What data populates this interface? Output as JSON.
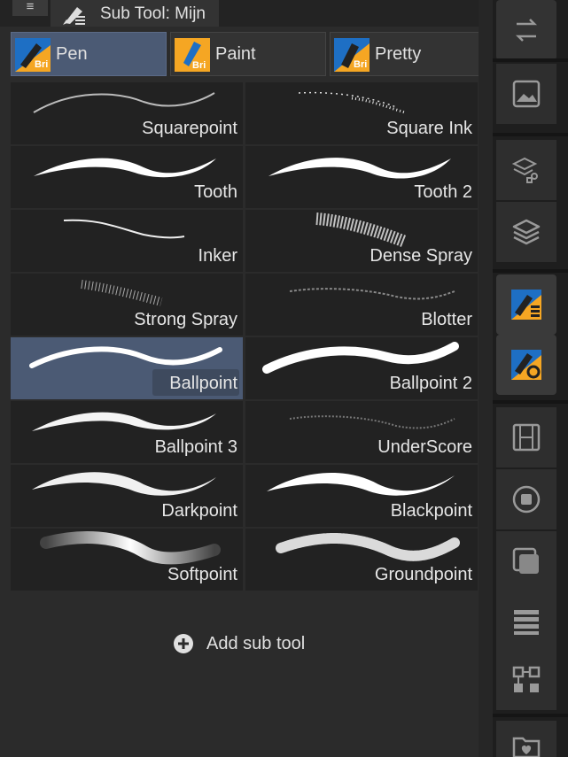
{
  "titlebar": {
    "menu_glyph": "≡",
    "title": "Sub Tool: Mijn"
  },
  "groups": [
    {
      "label": "Pen",
      "active": true,
      "icon": "pen-group-icon"
    },
    {
      "label": "Paint",
      "active": false,
      "icon": "paint-group-icon"
    },
    {
      "label": "Pretty",
      "active": false,
      "icon": "pretty-group-icon"
    }
  ],
  "subtools": [
    {
      "label": "Squarepoint",
      "selected": false
    },
    {
      "label": "Square Ink",
      "selected": false
    },
    {
      "label": "Tooth",
      "selected": false
    },
    {
      "label": "Tooth 2",
      "selected": false
    },
    {
      "label": "Inker",
      "selected": false
    },
    {
      "label": "Dense Spray",
      "selected": false
    },
    {
      "label": "Strong Spray",
      "selected": false
    },
    {
      "label": "Blotter",
      "selected": false
    },
    {
      "label": "Ballpoint",
      "selected": true
    },
    {
      "label": "Ballpoint 2",
      "selected": false
    },
    {
      "label": "Ballpoint 3",
      "selected": false
    },
    {
      "label": "UnderScore",
      "selected": false
    },
    {
      "label": "Darkpoint",
      "selected": false
    },
    {
      "label": "Blackpoint",
      "selected": false
    },
    {
      "label": "Softpoint",
      "selected": false
    },
    {
      "label": "Groundpoint",
      "selected": false
    }
  ],
  "add_subtool": {
    "label": "Add sub tool"
  },
  "dock_icons": [
    "swap-arrows-icon",
    "navigator-image-icon",
    "layer-property-icon",
    "layers-icon",
    "subtool-panel-icon",
    "tool-property-icon",
    "animation-filmstrip-icon",
    "color-circle-icon",
    "color-square-icon",
    "layer-list-icon",
    "node-tree-icon",
    "material-folder-icon"
  ],
  "colors": {
    "accent": "#4b5a74",
    "brand_orange": "#f5a623",
    "brand_blue": "#1e6fc4"
  }
}
